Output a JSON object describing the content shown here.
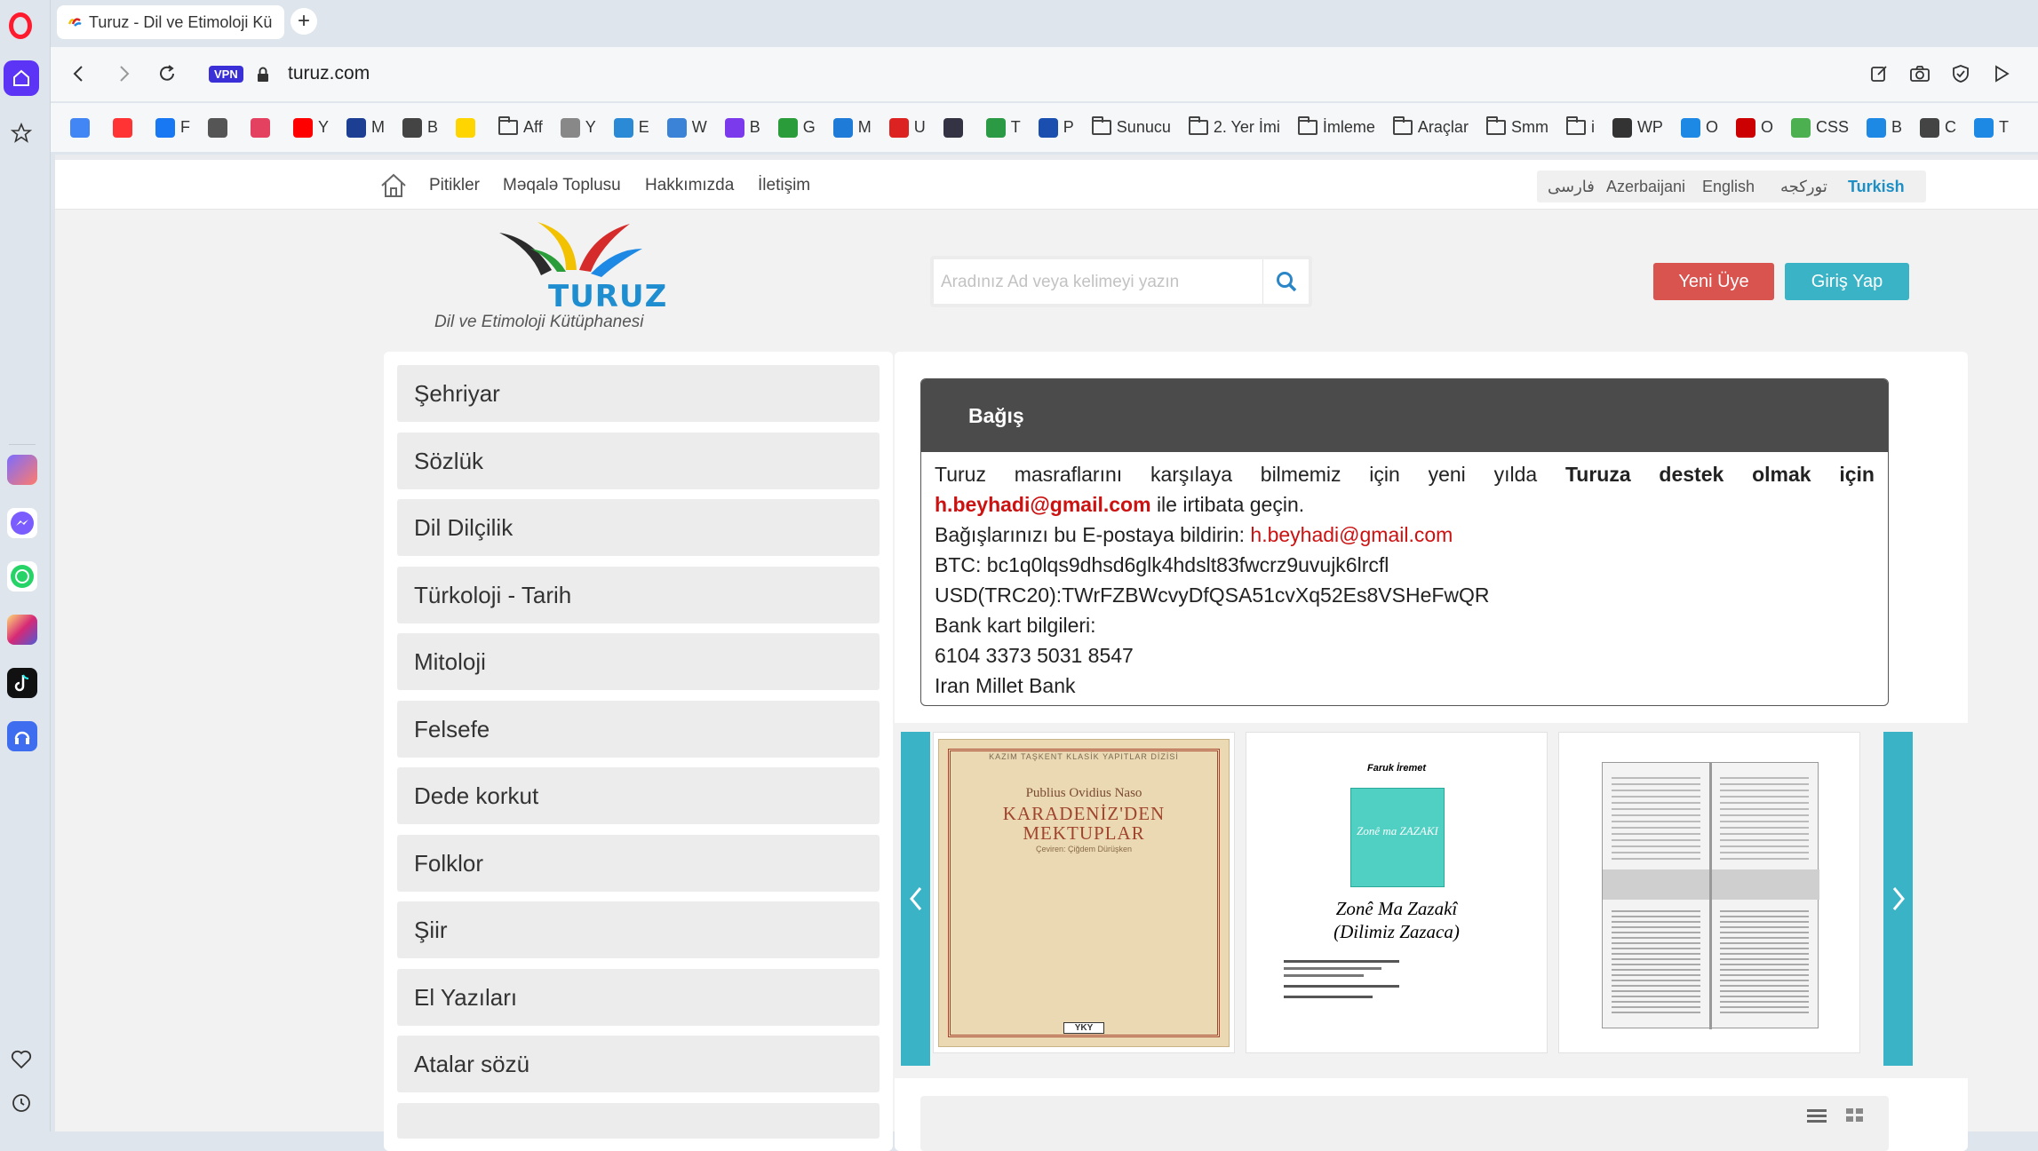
{
  "browser": {
    "tab_title": "Turuz - Dil ve Etimoloji Kü",
    "url": "turuz.com",
    "vpn_label": "VPN"
  },
  "bookmarks": [
    {
      "label": "",
      "icon": "google-icon",
      "color": "#4285f4"
    },
    {
      "label": "",
      "icon": "yandex-icon",
      "color": "#f33"
    },
    {
      "label": "F",
      "icon": "facebook-icon",
      "color": "#1877f2"
    },
    {
      "label": "",
      "icon": "calendar-icon",
      "color": "#555"
    },
    {
      "label": "",
      "icon": "instagram-icon",
      "color": "#e4405f"
    },
    {
      "label": "Y",
      "icon": "youtube-icon",
      "color": "#ff0000"
    },
    {
      "label": "M",
      "icon": "m-icon",
      "color": "#1c3f94"
    },
    {
      "label": "B",
      "icon": "doc-icon",
      "color": "#444"
    },
    {
      "label": "",
      "icon": "s-icon",
      "color": "#ffd500"
    },
    {
      "label": "Aff",
      "icon": "folder",
      "color": ""
    },
    {
      "label": "Y",
      "icon": "infinity-icon",
      "color": "#888"
    },
    {
      "label": "E",
      "icon": "en-icon",
      "color": "#2b8ad6"
    },
    {
      "label": "W",
      "icon": "wifi-icon",
      "color": "#3b83d6"
    },
    {
      "label": "B",
      "icon": "b-icon",
      "color": "#7c3aed"
    },
    {
      "label": "G",
      "icon": "clover-icon",
      "color": "#2a9d3a"
    },
    {
      "label": "M",
      "icon": "wave-icon",
      "color": "#1e7bd8"
    },
    {
      "label": "U",
      "icon": "u-icon",
      "color": "#d22"
    },
    {
      "label": "",
      "icon": "flag-icon",
      "color": "#334"
    },
    {
      "label": "T",
      "icon": "leaf-icon",
      "color": "#2b9a44"
    },
    {
      "label": "P",
      "icon": "p-icon",
      "color": "#1a4fb0"
    },
    {
      "label": "Sunucu",
      "icon": "folder",
      "color": ""
    },
    {
      "label": "2. Yer İmi",
      "icon": "folder",
      "color": ""
    },
    {
      "label": "İmleme",
      "icon": "folder",
      "color": ""
    },
    {
      "label": "Araçlar",
      "icon": "folder",
      "color": ""
    },
    {
      "label": "Smm",
      "icon": "folder",
      "color": ""
    },
    {
      "label": "i",
      "icon": "folder",
      "color": ""
    },
    {
      "label": "WP",
      "icon": "barcode-icon",
      "color": "#333"
    },
    {
      "label": "O",
      "icon": "cloud-icon",
      "color": "#1e88e5"
    },
    {
      "label": "O",
      "icon": "hand-icon",
      "color": "#c00"
    },
    {
      "label": "CSS",
      "icon": "css-icon",
      "color": "#4caf50"
    },
    {
      "label": "B",
      "icon": "signal-icon",
      "color": "#1e88e5"
    },
    {
      "label": "C",
      "icon": "gear-icon",
      "color": "#444"
    },
    {
      "label": "T",
      "icon": "signal-icon",
      "color": "#1e88e5"
    }
  ],
  "site": {
    "nav": [
      "Pitikler",
      "Məqalə Toplusu",
      "Hakkımızda",
      "İletişim"
    ],
    "languages": [
      "فارسی",
      "Azerbaijani",
      "English",
      "تورکجه",
      "Turkish"
    ],
    "active_language": "Turkish",
    "logo_title": "TURUZ",
    "logo_subtitle": "Dil ve Etimoloji Kütüphanesi",
    "search_placeholder": "Aradınız Ad veya kelimeyi yazın",
    "register_label": "Yeni Üye",
    "login_label": "Giriş Yap"
  },
  "categories": [
    "Şehriyar",
    "Sözlük",
    "Dil Dilçilik",
    "Türkoloji - Tarih",
    "Mitoloji",
    "Felsefe",
    "Dede korkut",
    "Folklor",
    "Şiir",
    "El Yazıları",
    "Atalar sözü"
  ],
  "donation": {
    "title": "Bağış",
    "line1_words": [
      "Turuz",
      "masraflarını",
      "karşılaya",
      "bilmemiz",
      "için",
      "yeni",
      "yılda"
    ],
    "line1_bold_words": [
      "Turuza",
      "destek",
      "olmak",
      "için"
    ],
    "email": "h.beyhadi@gmail.com",
    "line2_suffix": "ile irtibata geçin.",
    "line3_prefix": "Bağışlarınızı bu E-postaya bildirin:",
    "btc": "BTC: bc1q0lqs9dhsd6glk4hdslt83fwcrz9uvujk6lrcfl",
    "usd": "USD(TRC20):TWrFZBWcvyDfQSA51cvXq52Es8VSHeFwQR",
    "bank_label": "Bank kart bilgileri:",
    "card_number": "6104 3373 5031 8547",
    "bank_name": "Iran Millet Bank"
  },
  "books": [
    {
      "series": "KAZIM TAŞKENT KLASİK YAPITLAR DİZİSİ",
      "author": "Publius Ovidius Naso",
      "title": "KARADENİZ'DEN MEKTUPLAR",
      "translator": "Çeviren: Çiğdem Dürüşken",
      "publisher": "YKY"
    },
    {
      "author": "Faruk İremet",
      "cover_title": "Zonê ma ZAZAKI",
      "title": "Zonê Ma Zazakî",
      "subtitle": "(Dilimiz Zazaca)"
    },
    {
      "title": ""
    }
  ]
}
